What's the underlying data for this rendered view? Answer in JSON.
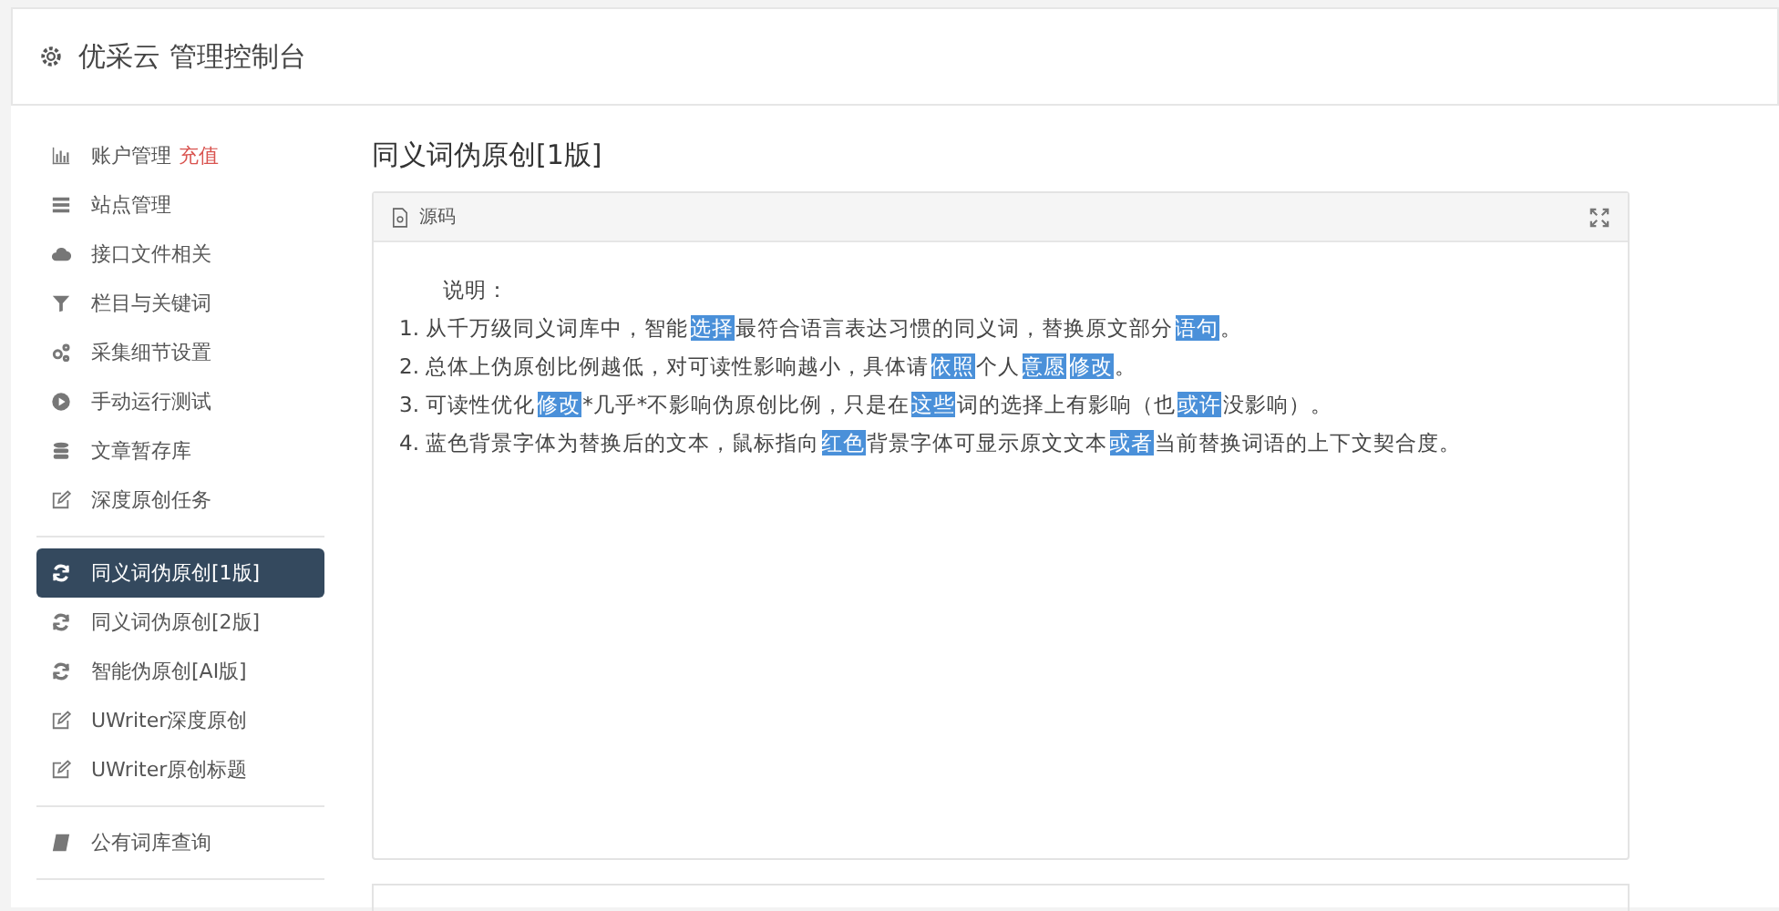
{
  "header": {
    "title": "优采云 管理控制台"
  },
  "sidebar": {
    "groups": [
      {
        "items": [
          {
            "label": "账户管理",
            "badge": "充值",
            "kind": "chart",
            "selected": false
          },
          {
            "label": "站点管理",
            "kind": "list",
            "selected": false
          },
          {
            "label": "接口文件相关",
            "kind": "cloud",
            "selected": false
          },
          {
            "label": "栏目与关键词",
            "kind": "filter",
            "selected": false
          },
          {
            "label": "采集细节设置",
            "kind": "gears",
            "selected": false
          },
          {
            "label": "手动运行测试",
            "kind": "play",
            "selected": false
          },
          {
            "label": "文章暂存库",
            "kind": "db",
            "selected": false
          },
          {
            "label": "深度原创任务",
            "kind": "edit",
            "selected": false
          }
        ]
      },
      {
        "items": [
          {
            "label": "同义词伪原创[1版]",
            "kind": "refresh",
            "selected": true
          },
          {
            "label": "同义词伪原创[2版]",
            "kind": "refresh",
            "selected": false
          },
          {
            "label": "智能伪原创[AI版]",
            "kind": "refresh",
            "selected": false
          },
          {
            "label": "UWriter深度原创",
            "kind": "edit",
            "selected": false
          },
          {
            "label": "UWriter原创标题",
            "kind": "edit",
            "selected": false
          }
        ]
      },
      {
        "items": [
          {
            "label": "公有词库查询",
            "kind": "book",
            "selected": false
          }
        ]
      }
    ]
  },
  "page_title": "同义词伪原创[1版]",
  "panel": {
    "title": "源码",
    "intro": "说明：",
    "lines": [
      [
        {
          "text": "1. 从千万级同义词库中，智能",
          "highlight": false
        },
        {
          "text": "选择",
          "highlight": true
        },
        {
          "text": "最符合语言表达习惯的同义词，替换原文部分",
          "highlight": false
        },
        {
          "text": "语句",
          "highlight": true
        },
        {
          "text": "。",
          "highlight": false
        }
      ],
      [
        {
          "text": "2. 总体上伪原创比例越低，对可读性影响越小，具体请",
          "highlight": false
        },
        {
          "text": "依照",
          "highlight": true
        },
        {
          "text": "个人",
          "highlight": false
        },
        {
          "text": "意愿",
          "highlight": true
        },
        {
          "text": "修改",
          "highlight": true
        },
        {
          "text": "。",
          "highlight": false
        }
      ],
      [
        {
          "text": "3. 可读性优化",
          "highlight": false
        },
        {
          "text": "修改",
          "highlight": true
        },
        {
          "text": "*几乎*不影响伪原创比例，只是在",
          "highlight": false
        },
        {
          "text": "这些",
          "highlight": true
        },
        {
          "text": "词的选择上有影响（也",
          "highlight": false
        },
        {
          "text": "或许",
          "highlight": true
        },
        {
          "text": "没影响）。",
          "highlight": false
        }
      ],
      [
        {
          "text": "4. 蓝色背景字体为替换后的文本，鼠标指向",
          "highlight": false
        },
        {
          "text": "红色",
          "highlight": true
        },
        {
          "text": "背景字体可显示原文文本",
          "highlight": false
        },
        {
          "text": "或者",
          "highlight": true
        },
        {
          "text": "当前替换词语的上下文契合度。",
          "highlight": false
        }
      ]
    ]
  }
}
